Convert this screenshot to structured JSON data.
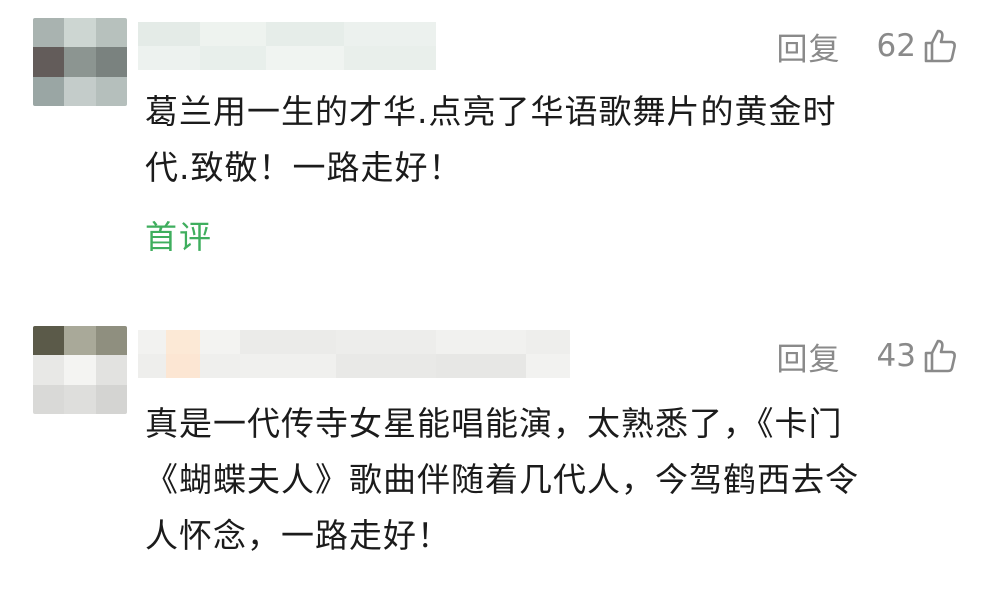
{
  "comments": [
    {
      "reply_label": "回复",
      "like_count": "62",
      "text": "葛兰用一生的才华.点亮了华语歌舞片的黄金时\n代.致敬！一路走好！",
      "tag": "首评"
    },
    {
      "reply_label": "回复",
      "like_count": "43",
      "text": "真是一代传寺女星能唱能演，太熟悉了，《卡门\n《蝴蝶夫人》歌曲伴随着几代人，今驾鹤西去令\n人怀念，一路走好！"
    }
  ],
  "colors": {
    "tag_green": "#3fae5e",
    "meta_gray": "#8a8a8a",
    "text_dark": "#1b1b1b"
  },
  "icons": {
    "like": "thumbs-up-icon"
  }
}
